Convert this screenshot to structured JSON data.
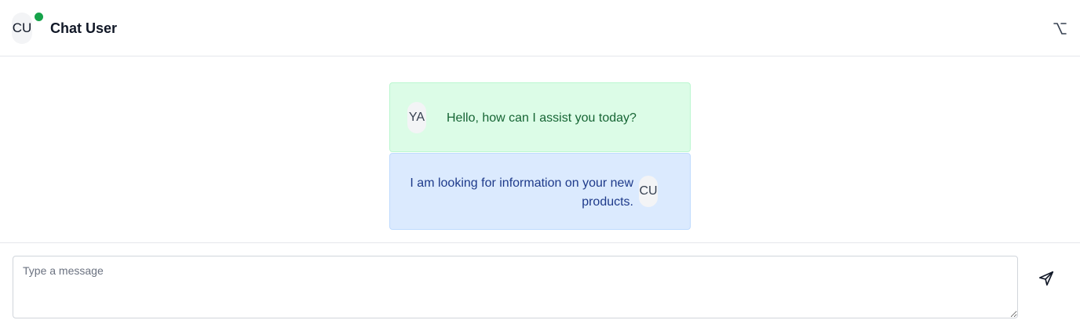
{
  "header": {
    "avatar_initials": "CU",
    "title": "Chat User",
    "status_color": "#16a34a",
    "status": "online",
    "menu_icon": "option-key-icon"
  },
  "messages": [
    {
      "role": "assistant",
      "avatar_initials": "YA",
      "text": "Hello, how can I assist you today?",
      "bubble_color": "#dcfce7"
    },
    {
      "role": "user",
      "avatar_initials": "CU",
      "text": "I am looking for information on your new products.",
      "bubble_color": "#dbeafe"
    }
  ],
  "composer": {
    "placeholder": "Type a message",
    "value": "",
    "send_icon": "send-icon"
  }
}
